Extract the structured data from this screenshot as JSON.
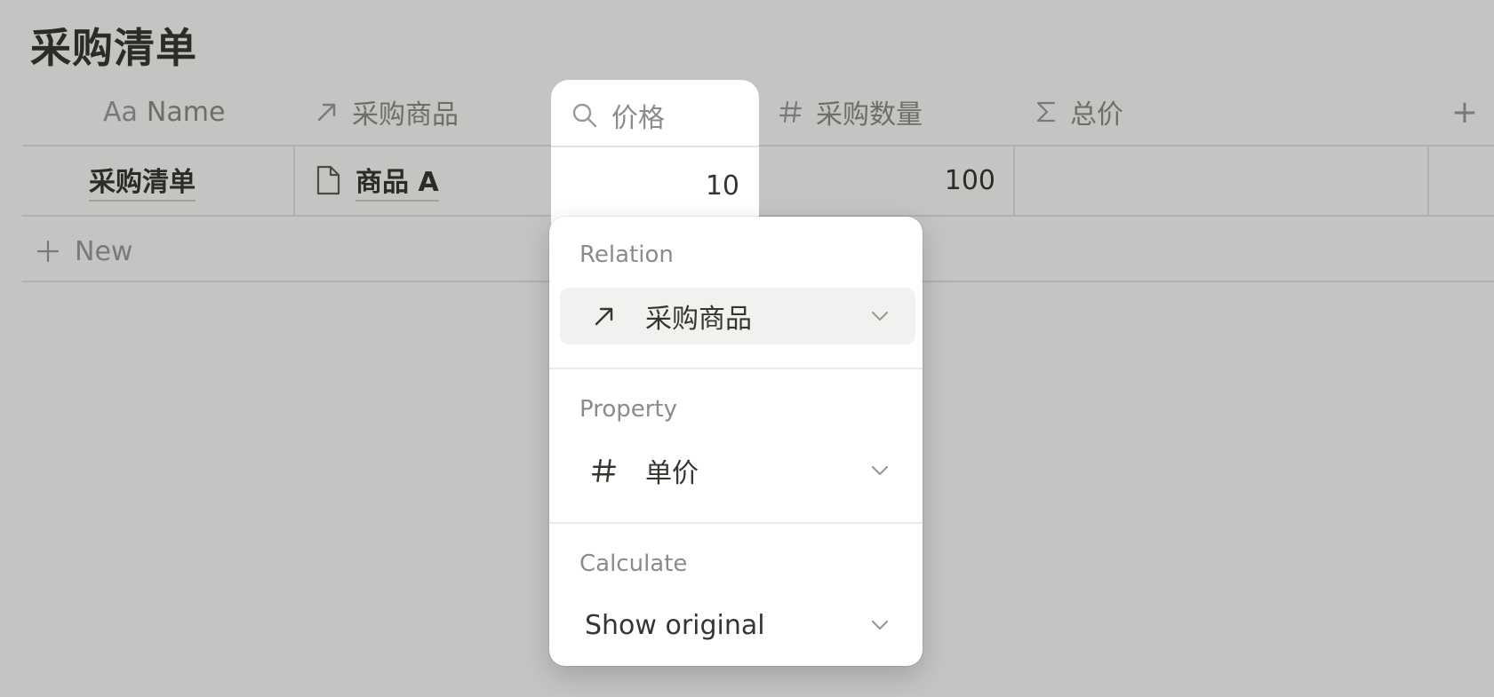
{
  "page": {
    "title": "采购清单"
  },
  "table": {
    "columns": [
      {
        "icon": "text-type-icon",
        "icon_text": "Aa",
        "label": "Name"
      },
      {
        "icon": "relation-arrow-icon",
        "label": "采购商品"
      },
      {
        "icon": "search-icon",
        "label": "价格"
      },
      {
        "icon": "hash-icon",
        "label": "采购数量"
      },
      {
        "icon": "sigma-icon",
        "label": "总价"
      }
    ],
    "add_column_label": "+",
    "rows": [
      {
        "name": "采购清单",
        "relation": "商品 A",
        "price": "10",
        "quantity": "100",
        "total": ""
      }
    ],
    "new_row_label": "New"
  },
  "popup": {
    "relation_label": "Relation",
    "relation_value": "采购商品",
    "property_label": "Property",
    "property_value": "单价",
    "calculate_label": "Calculate",
    "calculate_value": "Show original"
  },
  "colors": {
    "background": "#fbfbfa",
    "overlay": "rgba(15,15,15,0.23)",
    "text": "#37352f",
    "muted": "#8c8b87"
  }
}
